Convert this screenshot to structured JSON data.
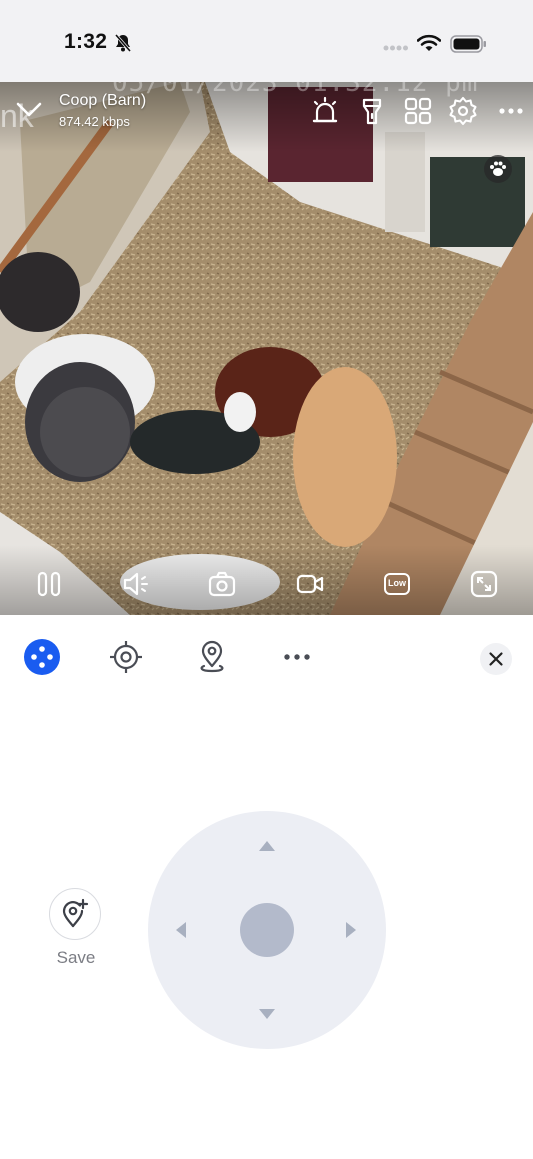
{
  "status_bar": {
    "time": "1:32",
    "icons": [
      "bell-slash-icon",
      "cellular-signal-icon",
      "wifi-icon",
      "battery-icon"
    ]
  },
  "camera": {
    "name": "Coop (Barn)",
    "bitrate": "874.42 kbps",
    "overlay_timestamp": "05/01/2023 01:32:12 pm",
    "top_actions": [
      "siren-icon",
      "spotlight-icon",
      "multi-view-icon",
      "settings-icon",
      "more-icon"
    ],
    "badge": "paw-icon",
    "watermark": "nk"
  },
  "controls": {
    "items": [
      "pause-icon",
      "speaker-icon",
      "snapshot-icon",
      "record-icon",
      "quality-icon",
      "fullscreen-icon"
    ],
    "quality_label": "Low"
  },
  "sheet": {
    "tabs": [
      "ptz-tab-icon",
      "tracking-tab-icon",
      "preset-location-tab-icon",
      "more-dots-icon"
    ],
    "active_tab": 0,
    "save_label": "Save"
  },
  "colors": {
    "accent": "#1a5cf0",
    "joystick_bg": "#eceef4",
    "joystick_knob": "#b3bacb",
    "arrow": "#a8b0c0"
  }
}
